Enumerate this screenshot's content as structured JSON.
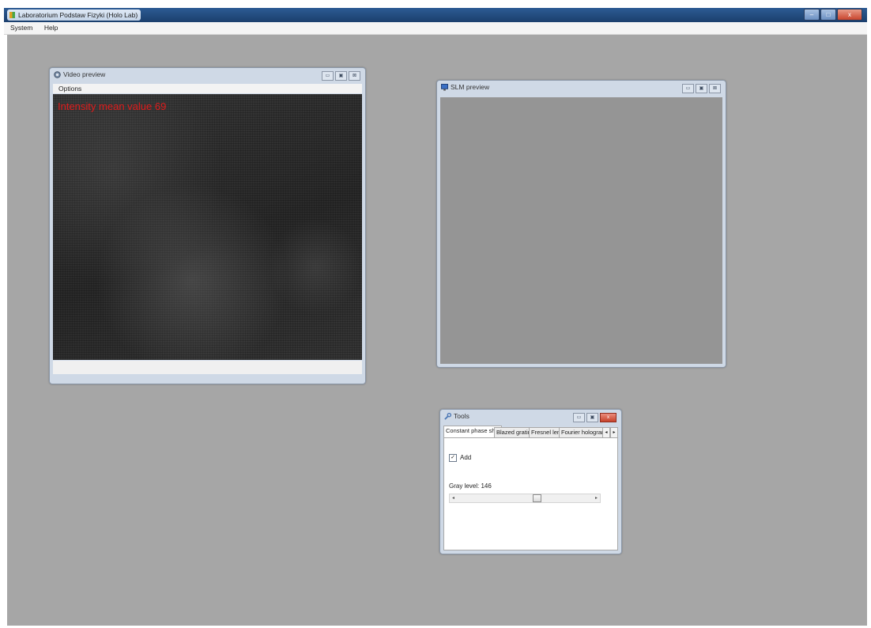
{
  "app": {
    "title": "Laboratorium Podstaw Fizyki (Holo Lab)",
    "menu": [
      "System",
      "Help"
    ],
    "controls": {
      "minimize": "–",
      "maximize": "□",
      "close": "x"
    }
  },
  "child_window_controls": {
    "minimize": "▭",
    "maximize": "▣",
    "close": "⊠",
    "close_x": "x"
  },
  "video_preview": {
    "title": "Video preview",
    "menu": [
      "Options"
    ],
    "overlay_text": "Intensity mean value 69"
  },
  "slm_preview": {
    "title": "SLM preview"
  },
  "tools": {
    "title": "Tools",
    "tabs": [
      "Constant phase shift",
      "Blazed grating",
      "Fresnel lens",
      "Fourier hologram"
    ],
    "tab_scroll": {
      "left": "◂",
      "right": "▸"
    },
    "add_checkbox": {
      "label": "Add",
      "checked": true,
      "mark": "✓"
    },
    "gray_level_label": "Gray level: 146",
    "gray_level": {
      "value": 146,
      "min": 0,
      "max": 255
    },
    "slider_arrows": {
      "left": "◂",
      "right": "▸"
    }
  },
  "colors": {
    "desktop": "#a6a6a6",
    "titlebar": "#1b3f6d",
    "overlay_text": "#e01b1b",
    "slm_gray": "#959595"
  },
  "icons": [
    "app-icon",
    "camera-icon",
    "monitor-icon",
    "tools-icon"
  ]
}
